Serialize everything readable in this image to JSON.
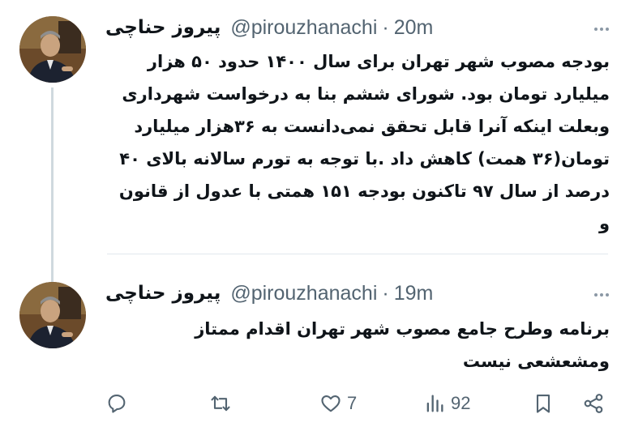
{
  "tweets": [
    {
      "author_name": "پیروز حناچی",
      "handle": "@pirouzhanachi",
      "separator": "·",
      "time": "20m",
      "lines": [
        "بودجه مصوب شهر تهران برای سال ۱۴۰۰ حدود ۵۰ هزار",
        "میلیارد تومان بود. شورای ششم بنا به درخواست شهرداری",
        "وبعلت اینکه آنرا قابل تحقق نمی‌دانست به ۳۶هزار میلیارد",
        "تومان(۳۶ همت) کاهش داد .با توجه به تورم سالانه بالای ۴۰",
        "درصد از سال ۹۷ تاکنون بودجه ۱۵۱ همتی با عدول از قانون",
        "و"
      ]
    },
    {
      "author_name": "پیروز حناچی",
      "handle": "@pirouzhanachi",
      "separator": "·",
      "time": "19m",
      "lines": [
        "برنامه وطرح جامع مصوب شهر تهران اقدام ممتاز",
        "ومشعشعی  نیست"
      ],
      "actions": {
        "reply_icon": "reply-icon",
        "retweet_icon": "retweet-icon",
        "like_icon": "heart-icon",
        "like_count": "7",
        "views_icon": "views-icon",
        "views_count": "92",
        "bookmark_icon": "bookmark-icon",
        "share_icon": "share-icon"
      }
    }
  ],
  "colors": {
    "text": "#0f1419",
    "secondary": "#536471",
    "thread_line": "#cfd9de"
  }
}
